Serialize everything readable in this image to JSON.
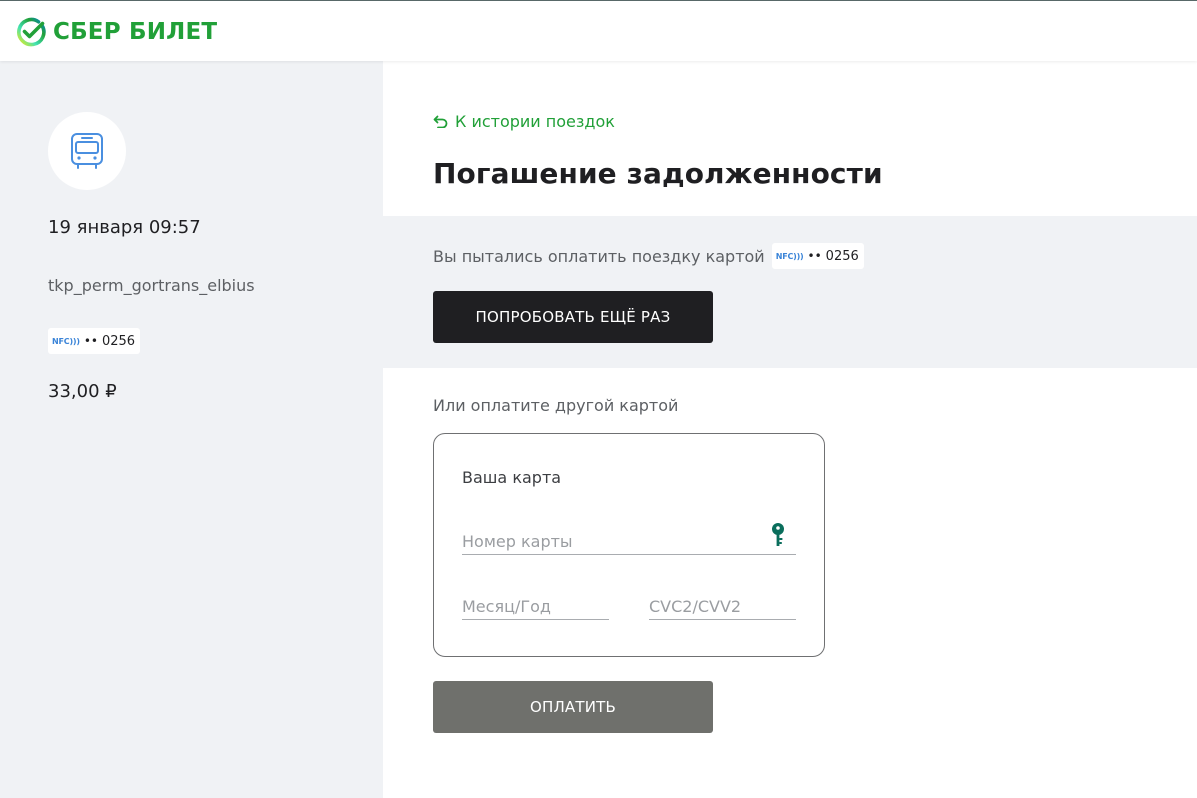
{
  "header": {
    "logo_text": "СБЕР БИЛЕТ",
    "brand_color": "#21a038"
  },
  "sidebar": {
    "transport_icon": "bus-icon",
    "datetime": "19 января 09:57",
    "operator": "tkp_perm_gortrans_elbius",
    "card": {
      "badge": "NFC",
      "badge_icon": "nfc-icon",
      "mask": "••",
      "last4": "0256"
    },
    "amount": "33,00 ₽"
  },
  "main": {
    "back_link": "К истории поездок",
    "back_icon": "back-arrow-icon",
    "title": "Погашение задолженности",
    "retry": {
      "text": "Вы пытались оплатить поездку картой",
      "card": {
        "badge": "NFC",
        "mask": "••",
        "last4": "0256"
      },
      "button_label": "ПОПРОБОВАТЬ ЕЩЁ РАЗ"
    },
    "other_card_label": "Или оплатите другой картой",
    "card_form": {
      "title": "Ваша карта",
      "card_number": {
        "value": "",
        "placeholder": "Номер карты"
      },
      "expiry": {
        "value": "",
        "placeholder": "Месяц/Год"
      },
      "cvc": {
        "value": "",
        "placeholder": "CVC2/CVV2"
      },
      "security_icon": "key-icon"
    },
    "pay_button_label": "ОПЛАТИТЬ"
  },
  "colors": {
    "accent_green": "#21a038",
    "sidebar_bg": "#f0f2f5",
    "dark_button": "#1f1f22",
    "pay_button": "#6f706c",
    "nfc_blue": "#3a84d8",
    "key_teal": "#0a6e5c"
  }
}
